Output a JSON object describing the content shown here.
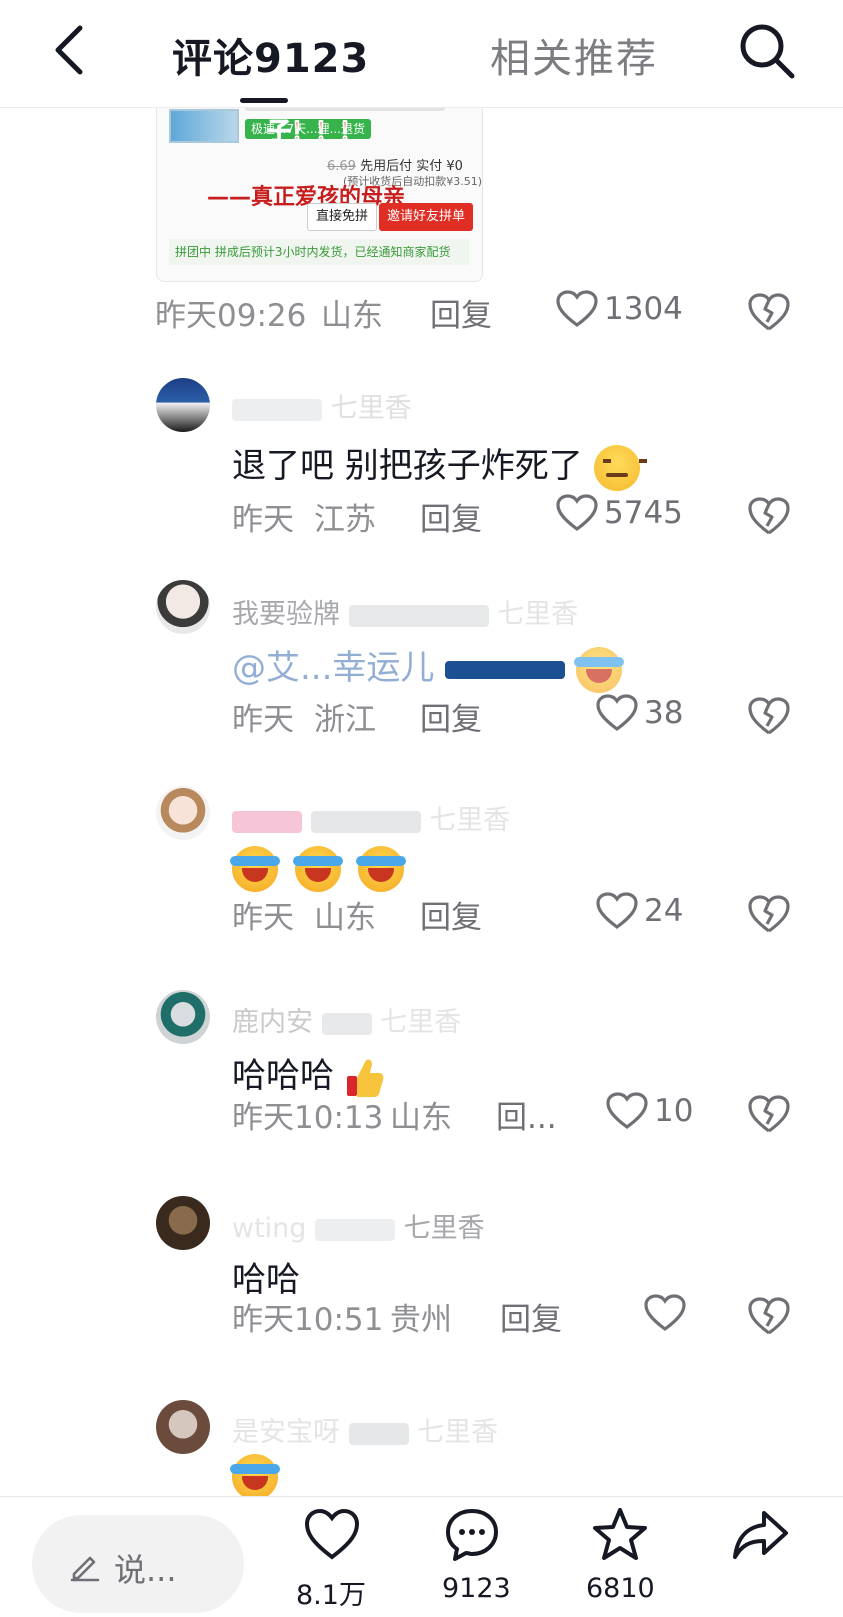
{
  "header": {
    "comments_tab": "评论9123",
    "related_tab": "相关推荐"
  },
  "card": {
    "big_red_text": "子！！！",
    "green_tag": "极速...7天...理...退货",
    "price_old": "6.69",
    "price_label": "先用后付 实付",
    "price_value": "¥0",
    "price_sub": "(预计收货后自动扣款¥3.51)",
    "overlay_text": "——真正爱孩的母亲",
    "button_direct": "直接免拼",
    "button_invite": "邀请好友拼单",
    "group_row": "拼团中 拼成后预计3小时内发货，已经通知商家配货"
  },
  "post_meta": {
    "time": "昨天09:26",
    "location": "山东",
    "reply": "回复",
    "likes": "1304"
  },
  "comments": [
    {
      "username": "七里香",
      "text": "退了吧  别把孩子炸死了",
      "time": "昨天",
      "location": "江苏",
      "reply": "回复",
      "likes": "5745"
    },
    {
      "username": "我要验牌",
      "username_tail": "七里香",
      "text": "@艾...幸运儿",
      "time": "昨天",
      "location": "浙江",
      "reply": "回复",
      "likes": "38"
    },
    {
      "username": "",
      "username_tail": "七里香",
      "text": "",
      "time": "昨天",
      "location": "山东",
      "reply": "回复",
      "likes": "24"
    },
    {
      "username": "鹿内安",
      "username_tail": "七里香",
      "text": "哈哈哈",
      "time": "昨天10:13",
      "location": "山东",
      "reply": "回...",
      "likes": "10"
    },
    {
      "username": "wting",
      "username_tail": "七里香",
      "text": "哈哈",
      "time": "昨天10:51",
      "location": "贵州",
      "reply": "回复",
      "likes": ""
    },
    {
      "username": "是安宝呀",
      "username_tail": "七里香",
      "text": "",
      "time": "",
      "location": "",
      "reply": "",
      "likes": ""
    }
  ],
  "bottom": {
    "say_placeholder": "说...",
    "likes_count": "8.1万",
    "comments_count": "9123",
    "favorites_count": "6810"
  },
  "colors": {
    "text": "#161823",
    "muted": "#8e8f93",
    "accent_red": "#e02e24"
  }
}
